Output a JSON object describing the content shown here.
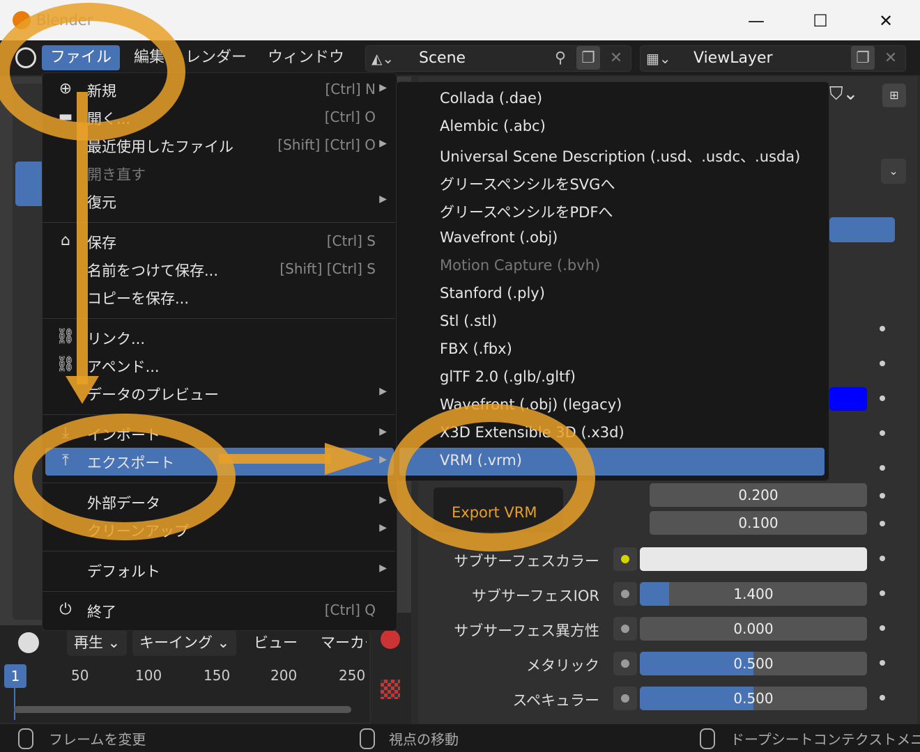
{
  "window": {
    "title": "Blender",
    "minimize": "—",
    "maximize": "☐",
    "close": "✕"
  },
  "menubar": {
    "items": [
      {
        "label": "ファイル",
        "active": true
      },
      {
        "label": "編集"
      },
      {
        "label": "レンダー"
      },
      {
        "label": "ウィンドウ"
      }
    ],
    "scene": "Scene",
    "view_layer": "ViewLayer"
  },
  "file_menu": {
    "items": [
      {
        "label": "新規",
        "shortcut": "[Ctrl] N",
        "arrow": true,
        "icon": "new-file-icon"
      },
      {
        "label": "開く...",
        "shortcut": "[Ctrl] O",
        "icon": "folder-icon"
      },
      {
        "label": "最近使用したファイル",
        "shortcut": "[Shift] [Ctrl] O",
        "arrow": true
      },
      {
        "label": "開き直す",
        "dim": true
      },
      {
        "label": "復元",
        "arrow": true
      },
      {
        "label": "保存",
        "shortcut": "[Ctrl] S",
        "icon": "save-icon"
      },
      {
        "label": "名前をつけて保存...",
        "shortcut": "[Shift] [Ctrl] S"
      },
      {
        "label": "コピーを保存..."
      },
      {
        "label": "リンク...",
        "icon": "link-icon"
      },
      {
        "label": "アペンド...",
        "icon": "append-icon"
      },
      {
        "label": "データのプレビュー",
        "arrow": true
      },
      {
        "label": "インポート",
        "arrow": true,
        "icon": "import-icon"
      },
      {
        "label": "エクスポート",
        "arrow": true,
        "icon": "export-icon",
        "highlight": true
      },
      {
        "label": "外部データ",
        "arrow": true
      },
      {
        "label": "クリーンアップ",
        "arrow": true
      },
      {
        "label": "デフォルト",
        "arrow": true
      },
      {
        "label": "終了",
        "shortcut": "[Ctrl] Q",
        "icon": "power-icon"
      }
    ]
  },
  "export_menu": {
    "items": [
      {
        "label": "Collada (.dae)"
      },
      {
        "label": "Alembic (.abc)"
      },
      {
        "label": "Universal Scene Description (.usd、.usdc、.usda)"
      },
      {
        "label": "グリースペンシルをSVGへ"
      },
      {
        "label": "グリースペンシルをPDFへ"
      },
      {
        "label": "Wavefront (.obj)"
      },
      {
        "label": "Motion Capture (.bvh)",
        "dim": true
      },
      {
        "label": "Stanford (.ply)"
      },
      {
        "label": "Stl (.stl)"
      },
      {
        "label": "FBX (.fbx)"
      },
      {
        "label": "glTF 2.0 (.glb/.gltf)"
      },
      {
        "label": "Wavefront (.obj) (legacy)"
      },
      {
        "label": "X3D Extensible 3D (.x3d)"
      },
      {
        "label": "VRM (.vrm)",
        "highlight": true
      }
    ]
  },
  "properties": {
    "export_vrm_button": "Export VRM",
    "values_top": [
      "0.200",
      "0.100"
    ],
    "rows": [
      {
        "label": "サブサーフェスカラー",
        "value": "",
        "fill": 0,
        "dot": "#d4d400"
      },
      {
        "label": "サブサーフェスIOR",
        "value": "1.400",
        "fill": 0.13
      },
      {
        "label": "サブサーフェス異方性",
        "value": "0.000",
        "fill": 0
      },
      {
        "label": "メタリック",
        "value": "0.500",
        "fill": 0.5
      },
      {
        "label": "スペキュラー",
        "value": "0.500",
        "fill": 0.5
      }
    ]
  },
  "timeline": {
    "menus": [
      "再生",
      "キーイング",
      "ビュー",
      "マーカー"
    ],
    "current_frame": "1",
    "ticks": [
      "50",
      "100",
      "150",
      "200",
      "250"
    ]
  },
  "statusbar": {
    "left": "フレームを変更",
    "middle": "視点の移動",
    "right": "ドープシートコンテクストメニュー"
  },
  "colors": {
    "accent": "#4772b3",
    "highlight_overlay": "#e8a028"
  }
}
